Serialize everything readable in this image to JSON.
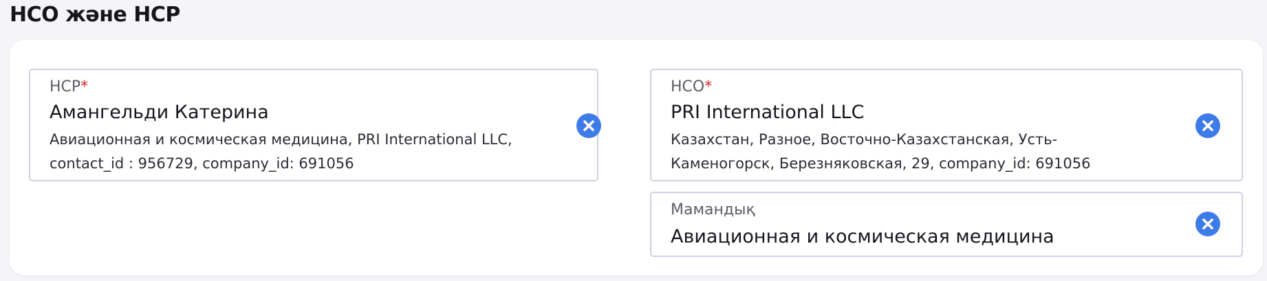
{
  "section": {
    "title": "НСО және НСР"
  },
  "fields": {
    "hcp": {
      "label": "НСР",
      "required_mark": "*",
      "value": "Амангельди Катерина",
      "details_line1": "Авиационная и космическая медицина, PRI International LLC,",
      "details_line2": "contact_id : 956729, company_id: 691056",
      "clear_icon": "close-circle-icon"
    },
    "hco": {
      "label": "НСО",
      "required_mark": "*",
      "value": "PRI International LLC",
      "details_line1": "Казахстан, Разное, Восточно-Казахстанская, Усть-",
      "details_line2": "Каменогорск,  Березняковская, 29, company_id: 691056",
      "clear_icon": "close-circle-icon"
    },
    "specialty": {
      "label": "Мамандық",
      "value": "Авиационная и космическая медицина",
      "clear_icon": "close-circle-icon"
    }
  },
  "colors": {
    "accent": "#3d7be8",
    "required": "#d42a2a",
    "border": "#cfd1e3",
    "page_bg": "#f5f4f9"
  }
}
